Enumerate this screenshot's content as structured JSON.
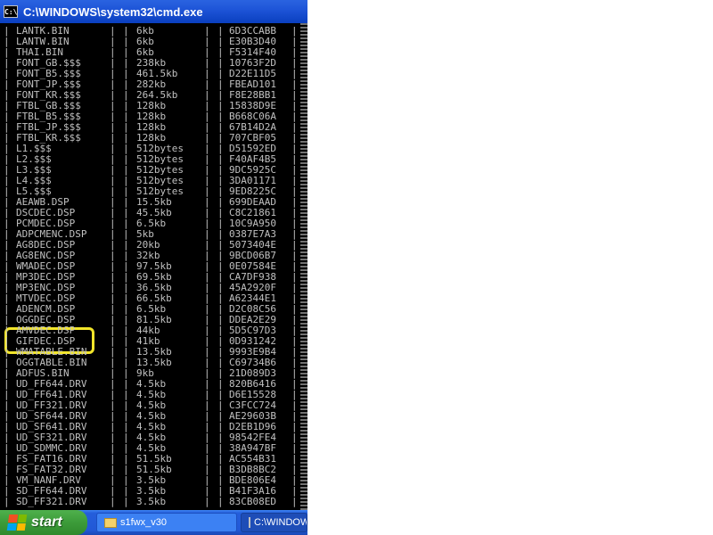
{
  "window": {
    "title": "C:\\WINDOWS\\system32\\cmd.exe",
    "icon": "cmd-icon",
    "icon_text": "C:\\"
  },
  "console": {
    "separator": "|",
    "rows": [
      {
        "name": "LANTK.BIN",
        "size": "6kb",
        "crc": "6D3CCABB"
      },
      {
        "name": "LANTW.BIN",
        "size": "6kb",
        "crc": "E30B3D40"
      },
      {
        "name": "THAI.BIN",
        "size": "6kb",
        "crc": "F5314F40"
      },
      {
        "name": "FONT_GB.$$$",
        "size": "238kb",
        "crc": "10763F2D"
      },
      {
        "name": "FONT_B5.$$$",
        "size": "461.5kb",
        "crc": "D22E11D5"
      },
      {
        "name": "FONT_JP.$$$",
        "size": "282kb",
        "crc": "FBEAD101"
      },
      {
        "name": "FONT_KR.$$$",
        "size": "264.5kb",
        "crc": "F8E28BB1"
      },
      {
        "name": "FTBL_GB.$$$",
        "size": "128kb",
        "crc": "15838D9E"
      },
      {
        "name": "FTBL_B5.$$$",
        "size": "128kb",
        "crc": "B668C06A"
      },
      {
        "name": "FTBL_JP.$$$",
        "size": "128kb",
        "crc": "67B14D2A"
      },
      {
        "name": "FTBL_KR.$$$",
        "size": "128kb",
        "crc": "707CBF05"
      },
      {
        "name": "L1.$$$",
        "size": "512bytes",
        "crc": "D51592ED"
      },
      {
        "name": "L2.$$$",
        "size": "512bytes",
        "crc": "F40AF4B5"
      },
      {
        "name": "L3.$$$",
        "size": "512bytes",
        "crc": "9DC5925C"
      },
      {
        "name": "L4.$$$",
        "size": "512bytes",
        "crc": "3DA01171"
      },
      {
        "name": "L5.$$$",
        "size": "512bytes",
        "crc": "9ED8225C"
      },
      {
        "name": "AEAWB.DSP",
        "size": "15.5kb",
        "crc": "699DEAAD"
      },
      {
        "name": "DSCDEC.DSP",
        "size": "45.5kb",
        "crc": "C8C21861"
      },
      {
        "name": "PCMDEC.DSP",
        "size": "6.5kb",
        "crc": "10C9A950"
      },
      {
        "name": "ADPCMENC.DSP",
        "size": "5kb",
        "crc": "0387E7A3"
      },
      {
        "name": "AG8DEC.DSP",
        "size": "20kb",
        "crc": "5073404E"
      },
      {
        "name": "AG8ENC.DSP",
        "size": "32kb",
        "crc": "9BCD06B7"
      },
      {
        "name": "WMADEC.DSP",
        "size": "97.5kb",
        "crc": "0E07584E"
      },
      {
        "name": "MP3DEC.DSP",
        "size": "69.5kb",
        "crc": "CA7DF938"
      },
      {
        "name": "MP3ENC.DSP",
        "size": "36.5kb",
        "crc": "45A2920F"
      },
      {
        "name": "MTVDEC.DSP",
        "size": "66.5kb",
        "crc": "A62344E1"
      },
      {
        "name": "ADENCM.DSP",
        "size": "6.5kb",
        "crc": "D2C08C56"
      },
      {
        "name": "OGGDEC.DSP",
        "size": "81.5kb",
        "crc": "DDEA2E29"
      },
      {
        "name": "AMVDEC.DSP",
        "size": "44kb",
        "crc": "5D5C97D3"
      },
      {
        "name": "GIFDEC.DSP",
        "size": "41kb",
        "crc": "0D931242"
      },
      {
        "name": "WMATABLE.BIN",
        "size": "13.5kb",
        "crc": "9993E9B4"
      },
      {
        "name": "OGGTABLE.BIN",
        "size": "13.5kb",
        "crc": "C69734B6"
      },
      {
        "name": "ADFUS.BIN",
        "size": "9kb",
        "crc": "21D089D3"
      },
      {
        "name": "UD_FF644.DRV",
        "size": "4.5kb",
        "crc": "820B6416"
      },
      {
        "name": "UD_FF641.DRV",
        "size": "4.5kb",
        "crc": "D6E15528"
      },
      {
        "name": "UD_FF321.DRV",
        "size": "4.5kb",
        "crc": "C3FCC724"
      },
      {
        "name": "UD_SF644.DRV",
        "size": "4.5kb",
        "crc": "AE29603B"
      },
      {
        "name": "UD_SF641.DRV",
        "size": "4.5kb",
        "crc": "D2EB1D96"
      },
      {
        "name": "UD_SF321.DRV",
        "size": "4.5kb",
        "crc": "98542FE4"
      },
      {
        "name": "UD_SDMMC.DRV",
        "size": "4.5kb",
        "crc": "38A947BF"
      },
      {
        "name": "FS_FAT16.DRV",
        "size": "51.5kb",
        "crc": "AC554B31"
      },
      {
        "name": "FS_FAT32.DRV",
        "size": "51.5kb",
        "crc": "B3DB8BC2"
      },
      {
        "name": "VM_NANF.DRV",
        "size": "3.5kb",
        "crc": "BDE806E4"
      },
      {
        "name": "SD_FF644.DRV",
        "size": "3.5kb",
        "crc": "B41F3A16"
      },
      {
        "name": "SD_FF321.DRV",
        "size": "3.5kb",
        "crc": "83CB08ED"
      }
    ]
  },
  "annotation": {
    "target_file": "OGGDEC.DSP",
    "color": "#f2e52a"
  },
  "taskbar": {
    "start_label": "start",
    "tasks": [
      {
        "label": "s1fwx_v30",
        "icon": "folder-icon"
      },
      {
        "label": "C:\\WINDOWS",
        "icon": "cmd-icon"
      }
    ]
  }
}
